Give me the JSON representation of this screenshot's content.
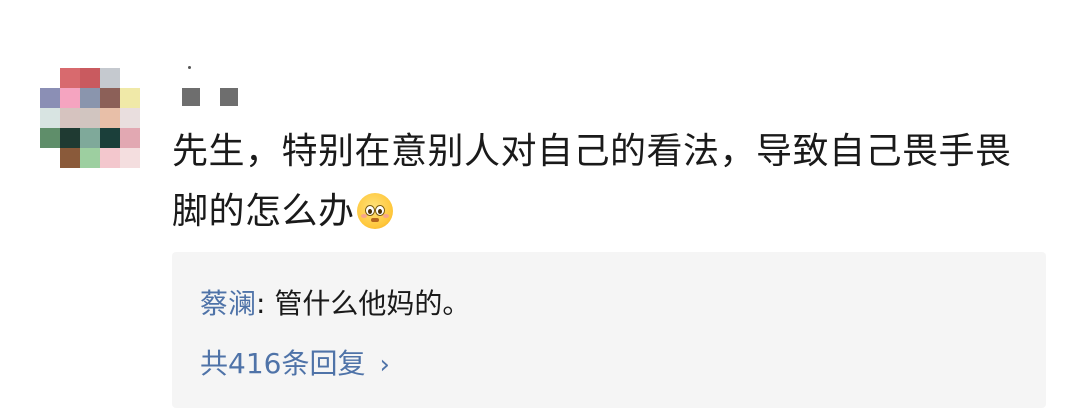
{
  "comment": {
    "text": "先生，特别在意别人对自己的看法，导致自己畏手畏脚的怎么办",
    "emoji": "flushed-face-emoji"
  },
  "reply": {
    "author": "蔡澜",
    "separator": ": ",
    "text": "管什么他妈的。"
  },
  "more_replies": {
    "label": "共416条回复",
    "chevron": "›"
  },
  "colors": {
    "link": "#4f73a8",
    "text": "#1a1a1a",
    "reply_bg": "#f5f5f5"
  }
}
